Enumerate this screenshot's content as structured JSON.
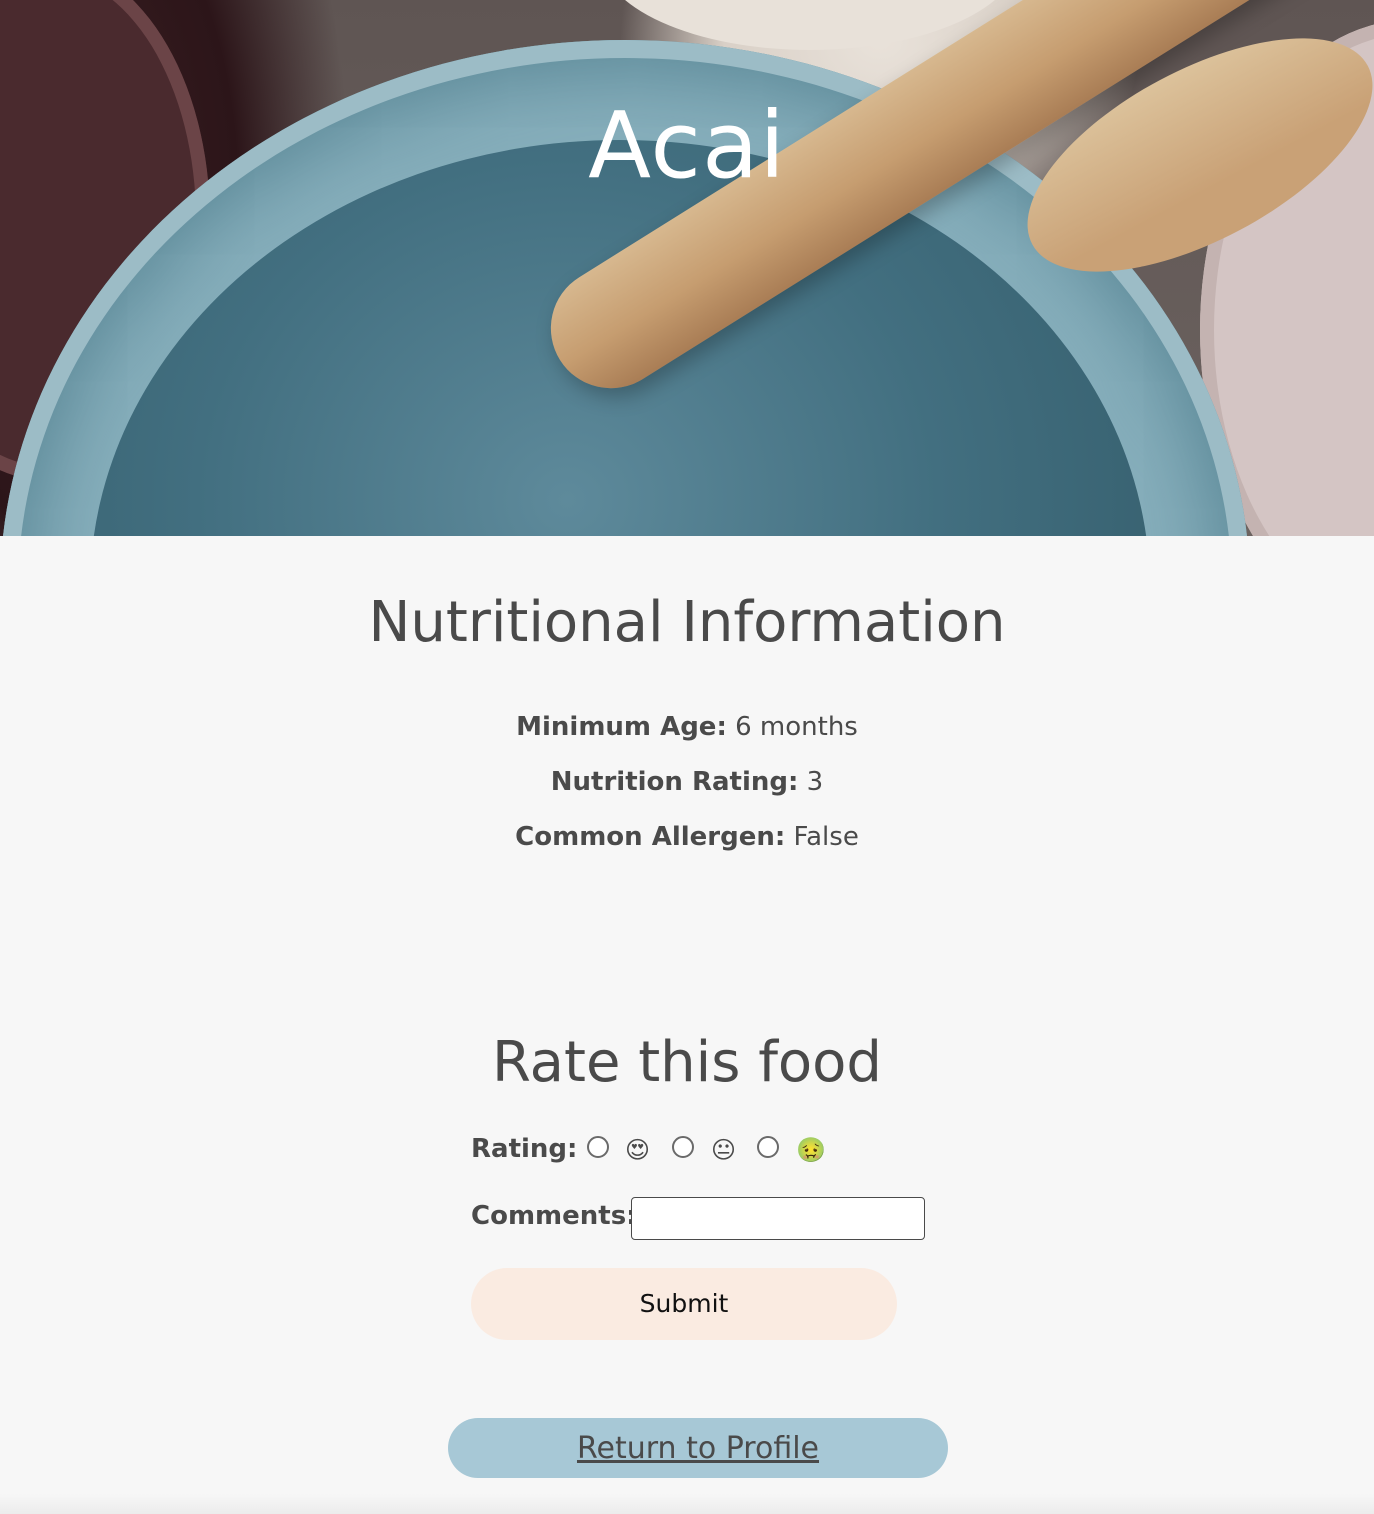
{
  "hero": {
    "title": "Acai"
  },
  "nutrition": {
    "heading": "Nutritional Information",
    "items": [
      {
        "label": "Minimum Age:",
        "value": "6 months"
      },
      {
        "label": "Nutrition Rating:",
        "value": "3"
      },
      {
        "label": "Common Allergen:",
        "value": "False"
      }
    ]
  },
  "rate": {
    "heading": "Rate this food",
    "rating_label": "Rating:",
    "options": [
      {
        "emoji": "😍",
        "icon": "heart-eyes-face-icon"
      },
      {
        "emoji": "😐",
        "icon": "neutral-face-icon"
      },
      {
        "emoji": "🤢",
        "icon": "nauseated-face-icon"
      }
    ],
    "comments_label": "Comments:",
    "comments_value": "",
    "submit_label": "Submit"
  },
  "return_link": {
    "label": "Return to Profile"
  },
  "colors": {
    "background": "#f7f7f7",
    "text": "#4a4a4a",
    "submit_bg": "#faebe1",
    "return_bg": "#a7c8d6"
  }
}
